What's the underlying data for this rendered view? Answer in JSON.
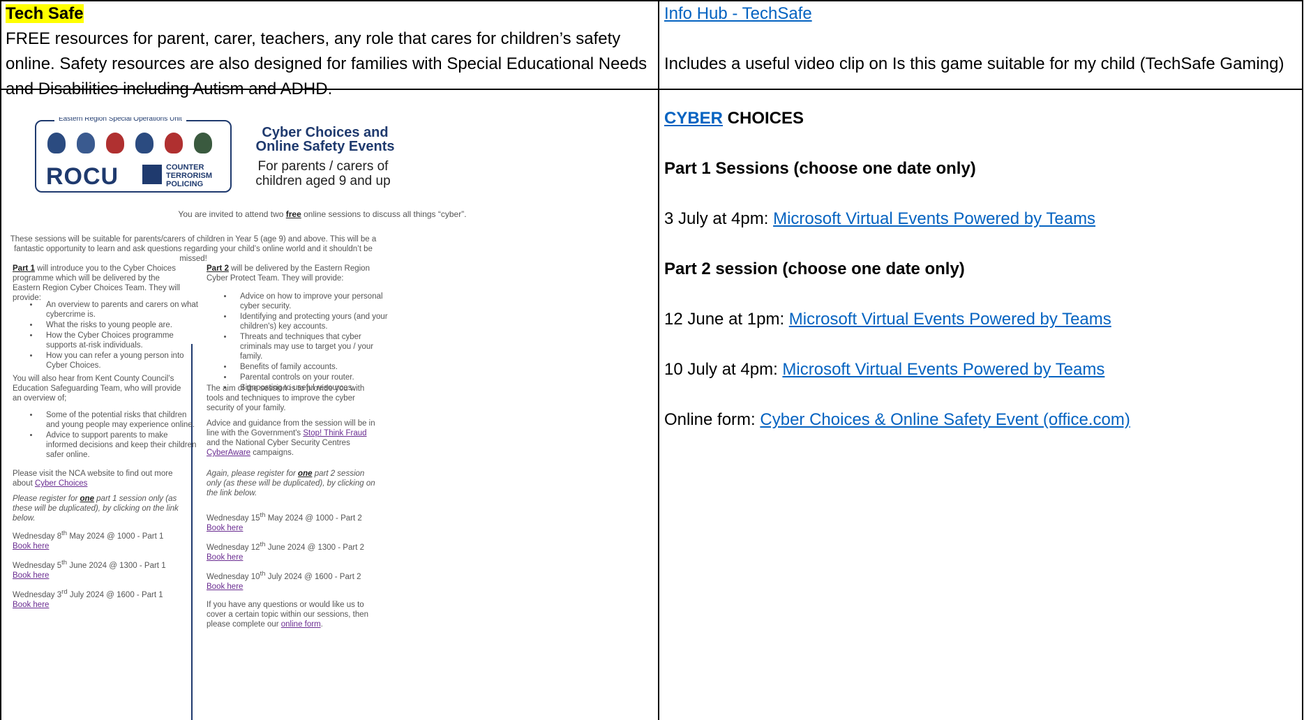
{
  "techsafe": {
    "label": "Tech Safe",
    "description": "FREE resources for parent, carer, teachers, any role that cares for children’s safety online. Safety resources are also designed for families with Special Educational Needs and Disabilities including Autism and ADHD."
  },
  "infohub": {
    "link": "Info Hub - TechSafe",
    "note": "Includes a useful video clip on Is this game suitable for my child (TechSafe Gaming)"
  },
  "cyber": {
    "link": "CYBER",
    "heading_rest": " CHOICES",
    "part1_heading": "Part 1 Sessions (choose one date only)",
    "sessions": [
      {
        "prefix": "3 July at 4pm: ",
        "link": "Microsoft Virtual Events Powered by Teams"
      },
      {
        "prefix": "12 June at 1pm: ",
        "link": "Microsoft Virtual Events Powered by Teams"
      },
      {
        "prefix": "10 July at 4pm: ",
        "link": "Microsoft Virtual Events Powered by Teams"
      }
    ],
    "part2_heading": "Part 2 session (choose one date only)",
    "form_prefix": "Online form: ",
    "form_link": "Cyber Choices & Online Safety Event (office.com)"
  },
  "flyer": {
    "unit_label": "Eastern Region Special Operations Unit",
    "rocu": "ROCU",
    "ct": [
      "COUNTER",
      "TERRORISM",
      "POLICING"
    ],
    "title": "Cyber Choices and Online Safety Events",
    "subtitle": "For parents / carers of children aged 9 and up",
    "invite_a": "You are invited to attend two ",
    "invite_free": "free",
    "invite_b": " online sessions to discuss all things “cyber”.",
    "suitable": "These sessions will be suitable for parents/carers of children in Year 5 (age 9) and above. This will be a fantastic opportunity to learn and ask questions regarding your child’s online world and it shouldn’t be missed!",
    "part1_label": "Part 1",
    "part1_intro": " will introduce you to the Cyber Choices programme which will be delivered by the Eastern Region Cyber Choices Team. They will provide:",
    "part1_list": [
      "An overview to parents and carers on what cybercrime is.",
      "What the risks to young people are.",
      "How the Cyber Choices programme supports at-risk individuals.",
      "How you can refer a young person into Cyber Choices."
    ],
    "kent_intro": "You will also hear from Kent County Council’s Education Safeguarding Team, who will provide an overview of;",
    "kent_list": [
      "Some of the potential risks that children and young people may experience online.",
      "Advice to support parents to make informed decisions and keep their children safer online."
    ],
    "nca_text": "Please visit the NCA website to find out more about ",
    "nca_link": "Cyber Choices",
    "reg1_a": "Please register for ",
    "reg1_one": "one",
    "reg1_b": " part 1 session only (as these will be duplicated), by clicking on the link below.",
    "part1_dates": [
      {
        "day": "Wednesday 8",
        "sup": "th",
        "rest": " May 2024 @ 1000 - Part 1",
        "book": "Book here"
      },
      {
        "day": "Wednesday 5",
        "sup": "th",
        "rest": " June 2024 @ 1300 - Part 1",
        "book": "Book here"
      },
      {
        "day": "Wednesday 3",
        "sup": "rd",
        "rest": " July 2024 @ 1600 - Part 1",
        "book": "Book here"
      }
    ],
    "part2_label": "Part 2",
    "part2_intro": " will be delivered by the Eastern Region Cyber Protect Team. They will provide:",
    "part2_list": [
      "Advice on how to improve your personal cyber security.",
      "Identifying and protecting yours (and your children's) key accounts.",
      "Threats and techniques that cyber criminals may use to target you / your family.",
      "Benefits of family accounts.",
      "Parental controls on your router.",
      "Signposting to useful resources."
    ],
    "aim": "The aim of the session is to provide you with tools and techniques to improve the cyber security of your family.",
    "advice_a": "Advice and guidance from the session will be in line with the Government's ",
    "advice_link1": "Stop! Think Fraud",
    "advice_b": " and the National Cyber Security Centres ",
    "advice_link2": "CyberAware",
    "advice_c": " campaigns.",
    "reg2_a": "Again, please register for ",
    "reg2_one": "one",
    "reg2_b": " part 2 session only (as these will be duplicated), by clicking on the link below.",
    "part2_dates": [
      {
        "day": "Wednesday 15",
        "sup": "th",
        "rest": " May 2024 @ 1000 - Part 2",
        "book": "Book here"
      },
      {
        "day": "Wednesday 12",
        "sup": "th",
        "rest": " June 2024 @ 1300 - Part 2",
        "book": "Book here"
      },
      {
        "day": "Wednesday 10",
        "sup": "th",
        "rest": " July 2024 @ 1600 - Part 2",
        "book": "Book here"
      }
    ],
    "questions_a": "If you have any questions or would like us to cover a certain topic within our sessions, then please complete our ",
    "questions_link": "online form",
    "questions_b": "."
  }
}
